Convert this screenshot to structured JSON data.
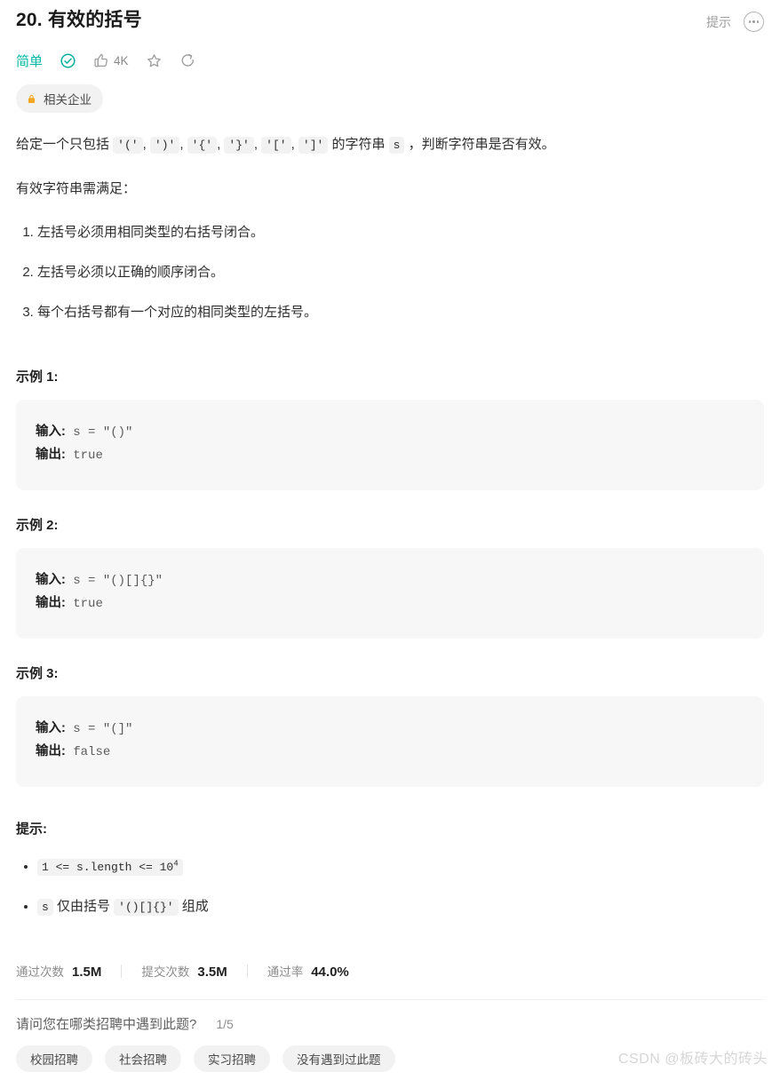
{
  "header": {
    "title": "20. 有效的括号",
    "hint_label": "提示",
    "more_icon": "ellipsis-circle-icon"
  },
  "meta": {
    "difficulty": "简单",
    "solved_icon": "check-circle-icon",
    "like_icon": "thumbs-up-icon",
    "like_count": "4K",
    "favorite_icon": "star-icon",
    "share_icon": "share-icon",
    "company_badge": {
      "lock_icon": "lock-icon",
      "label": "相关企业"
    }
  },
  "description": {
    "intro_prefix": "给定一个只包括 ",
    "intro_codes": [
      "'('",
      "')'",
      "'{'",
      "'}'",
      "'['",
      "']'"
    ],
    "intro_mid": " 的字符串 ",
    "intro_var": "s",
    "intro_suffix": " ，判断字符串是否有效。",
    "requirement_lead": "有效字符串需满足：",
    "rules": [
      "左括号必须用相同类型的右括号闭合。",
      "左括号必须以正确的顺序闭合。",
      "每个右括号都有一个对应的相同类型的左括号。"
    ]
  },
  "examples": [
    {
      "title": "示例 1:",
      "input_label": "输入:",
      "input_value": " s = \"()\"",
      "output_label": "输出:",
      "output_value": " true"
    },
    {
      "title": "示例 2:",
      "input_label": "输入:",
      "input_value": " s = \"()[]{}\"",
      "output_label": "输出:",
      "output_value": " true"
    },
    {
      "title": "示例 3:",
      "input_label": "输入:",
      "input_value": " s = \"(]\"",
      "output_label": "输出:",
      "output_value": " false"
    }
  ],
  "constraints": {
    "title": "提示:",
    "item1_code_prefix": "1 <= s.length <= 10",
    "item1_code_sup": "4",
    "item2_var": "s",
    "item2_mid": " 仅由括号 ",
    "item2_code": "'()[]{}'",
    "item2_suffix": " 组成"
  },
  "stats": [
    {
      "label": "通过次数",
      "value": "1.5M"
    },
    {
      "label": "提交次数",
      "value": "3.5M"
    },
    {
      "label": "通过率",
      "value": "44.0%"
    }
  ],
  "survey": {
    "question": "请问您在哪类招聘中遇到此题?",
    "counter": "1/5",
    "options": [
      "校园招聘",
      "社会招聘",
      "实习招聘",
      "没有遇到过此题"
    ]
  },
  "watermark": "CSDN @板砖大的砖头",
  "colors": {
    "difficulty": "#00b8a3",
    "solved": "#00af9b",
    "lock": "#f5a623",
    "code_bg": "#f7f7f8",
    "chip_bg": "#f2f2f3"
  }
}
